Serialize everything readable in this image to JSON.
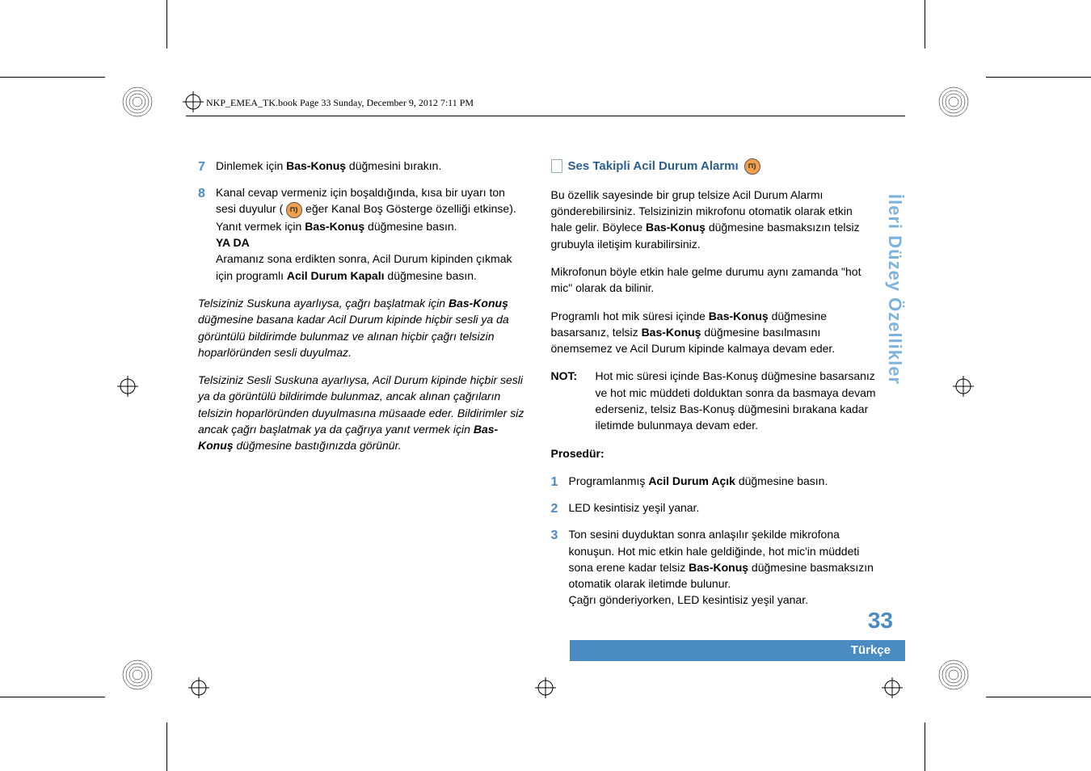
{
  "header": "NKP_EMEA_TK.book  Page 33  Sunday, December 9, 2012  7:11 PM",
  "left": {
    "step7": {
      "num": "7",
      "t1": "Dinlemek için ",
      "b1": "Bas-Konuş",
      "t2": " düğmesini bırakın."
    },
    "step8": {
      "num": "8",
      "l1a": "Kanal cevap vermeniz için boşaldığında, kısa bir uyarı ton sesi duyulur ( ",
      "l1b": " eğer Kanal Boş Gösterge özelliği etkinse). Yanıt vermek için ",
      "b1": "Bas-Konuş",
      "l1c": " düğmesine basın.",
      "yada": "YA DA",
      "l2a": "Aramanız sona erdikten sonra, Acil Durum kipinden çıkmak için programlı ",
      "b2": "Acil Durum Kapalı",
      "l2b": " düğmesine basın."
    },
    "it1a": "Telsiziniz Suskuna ayarlıysa, çağrı başlatmak için ",
    "it1b": "Bas-Konuş",
    "it1c": " düğmesine basana kadar Acil Durum kipinde hiçbir sesli ya da görüntülü bildirimde bulunmaz ve alınan hiçbir çağrı telsizin hoparlöründen sesli duyulmaz.",
    "it2a": "Telsiziniz Sesli Suskuna ayarlıysa, Acil Durum kipinde hiçbir sesli ya da görüntülü bildirimde bulunmaz, ancak alınan çağrıların telsizin hoparlöründen duyulmasına müsaade eder. Bildirimler siz ancak çağrı başlatmak ya da çağrıya yanıt vermek için ",
    "it2b": "Bas-Konuş",
    "it2c": " düğmesine bastığınızda görünür."
  },
  "right": {
    "title": "Ses Takipli Acil Durum Alarmı",
    "p1a": "Bu özellik sayesinde bir grup telsize Acil Durum Alarmı gönderebilirsiniz. Telsizinizin mikrofonu otomatik olarak etkin hale gelir. Böylece ",
    "p1b": "Bas-Konuş",
    "p1c": " düğmesine basmaksızın telsiz grubuyla iletişim kurabilirsiniz.",
    "p2": "Mikrofonun böyle etkin hale gelme durumu aynı zamanda \"hot mic\" olarak da bilinir.",
    "p3a": "Programlı hot mik süresi içinde ",
    "p3b": "Bas-Konuş",
    "p3c": " düğmesine basarsanız, telsiz ",
    "p3d": "Bas-Konuş",
    "p3e": " düğmesine basılmasını önemsemez ve Acil Durum kipinde kalmaya devam eder.",
    "noteLabel": "NOT:",
    "note": "Hot mic süresi içinde Bas-Konuş düğmesine basarsanız ve hot mic müddeti dolduktan sonra da basmaya devam ederseniz, telsiz Bas-Konuş düğmesini bırakana kadar iletimde bulunmaya devam eder.",
    "proc": "Prosedür:",
    "s1": {
      "num": "1",
      "a": "Programlanmış ",
      "b": "Acil Durum Açık",
      "c": " düğmesine basın."
    },
    "s2": {
      "num": "2",
      "t": "LED kesintisiz yeşil yanar."
    },
    "s3": {
      "num": "3",
      "a": "Ton sesini duyduktan sonra anlaşılır şekilde mikrofona konuşun. Hot mic etkin hale geldiğinde, hot mic'in müddeti sona erene kadar telsiz ",
      "b": "Bas-Konuş",
      "c": " düğmesine basmaksızın otomatik olarak iletimde bulunur.",
      "d": "Çağrı gönderiyorken, LED kesintisiz yeşil yanar."
    }
  },
  "sidebar": "İleri Düzey Özellikler",
  "pageNumber": "33",
  "language": "Türkçe"
}
